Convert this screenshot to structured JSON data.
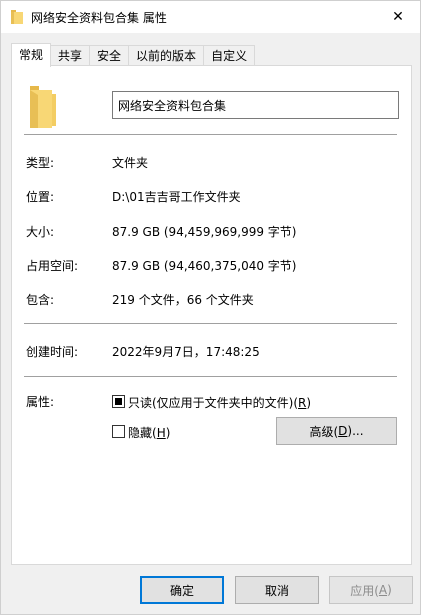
{
  "window": {
    "title": "网络安全资料包合集 属性",
    "close_glyph": "✕"
  },
  "tabs": [
    {
      "label": "常规",
      "active": true
    },
    {
      "label": "共享",
      "active": false
    },
    {
      "label": "安全",
      "active": false
    },
    {
      "label": "以前的版本",
      "active": false
    },
    {
      "label": "自定义",
      "active": false
    }
  ],
  "general": {
    "folder_name": "网络安全资料包合集",
    "type_label": "类型:",
    "type_value": "文件夹",
    "location_label": "位置:",
    "location_value": "D:\\01吉吉哥工作文件夹",
    "size_label": "大小:",
    "size_value": "87.9 GB (94,459,969,999 字节)",
    "size_on_disk_label": "占用空间:",
    "size_on_disk_value": "87.9 GB (94,460,375,040 字节)",
    "contains_label": "包含:",
    "contains_value": "219 个文件，66 个文件夹",
    "created_label": "创建时间:",
    "created_value": "2022年9月7日，17:48:25",
    "attributes_label": "属性:",
    "readonly_text": "只读(仅应用于文件夹中的文件)(",
    "readonly_key": "R",
    "readonly_close": ")",
    "hidden_text": "隐藏(",
    "hidden_key": "H",
    "hidden_close": ")",
    "advanced_text": "高级(",
    "advanced_key": "D",
    "advanced_close": ")..."
  },
  "footer": {
    "ok": "确定",
    "cancel": "取消",
    "apply_text": "应用(",
    "apply_key": "A",
    "apply_close": ")"
  },
  "colors": {
    "folder": "#f8d775",
    "focus": "#0078d7"
  }
}
